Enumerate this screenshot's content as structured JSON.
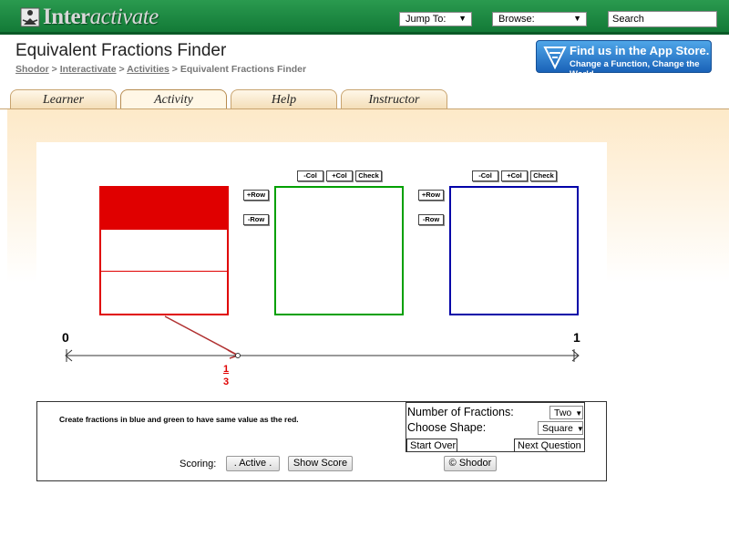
{
  "header": {
    "logo_prefix": "Inter",
    "logo_suffix": "activate",
    "jump_label": "Jump To:",
    "browse_label": "Browse:",
    "search_placeholder": "Search"
  },
  "title": "Equivalent Fractions Finder",
  "breadcrumb": [
    "Shodor",
    "Interactivate",
    "Activities",
    "Equivalent Fractions Finder"
  ],
  "appstore": {
    "line1": "Find us in the App Store.",
    "line2": "Change a Function, Change the World"
  },
  "tabs": [
    {
      "label": "Learner",
      "active": false
    },
    {
      "label": "Activity",
      "active": true
    },
    {
      "label": "Help",
      "active": false
    },
    {
      "label": "Instructor",
      "active": false
    }
  ],
  "activity": {
    "col_buttons": [
      "-Col",
      "+Col",
      "Check"
    ],
    "row_buttons": [
      "+Row",
      "-Row"
    ],
    "red_fraction": {
      "numerator": "1",
      "denominator": "3",
      "filled_rows": 1,
      "total_rows": 3
    },
    "number_line": {
      "start": "0",
      "end": "1"
    },
    "colors": {
      "red": "#e00000",
      "green": "#00a000",
      "blue": "#0000a8"
    }
  },
  "panel": {
    "instructions": "Create fractions in blue and green to have same value as the red.",
    "num_fractions_label": "Number of Fractions:",
    "num_fractions_value": "Two",
    "shape_label": "Choose Shape:",
    "shape_value": "Square",
    "start_over": "Start Over",
    "next_question": "Next Question",
    "scoring_label": "Scoring:",
    "active_button": ". Active .",
    "show_score": "Show Score",
    "shodor_button": "© Shodor"
  }
}
